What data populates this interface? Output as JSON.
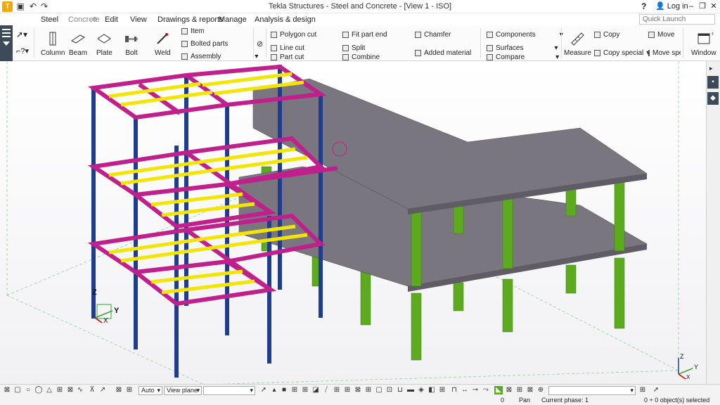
{
  "window": {
    "title": "Tekla Structures - Steel and Concrete  - [View 1 - ISO]",
    "help": "?",
    "login": "Log in"
  },
  "tabs": [
    "Steel",
    "Concrete",
    "Edit",
    "View",
    "Drawings & reports",
    "Manage",
    "Analysis & design"
  ],
  "quick_launch": {
    "placeholder": "Quick Launch"
  },
  "ribbon": {
    "column": "Column",
    "beam": "Beam",
    "plate": "Plate",
    "bolt": "Bolt",
    "weld": "Weld",
    "item": "Item",
    "bolted_parts": "Bolted parts",
    "assembly": "Assembly",
    "polygon_cut": "Polygon cut",
    "line_cut": "Line cut",
    "part_cut": "Part cut",
    "fit_part_end": "Fit part end",
    "split": "Split",
    "combine": "Combine",
    "chamfer": "Chamfer",
    "added_material": "Added material",
    "components": "Components",
    "surfaces": "Surfaces",
    "compare": "Compare",
    "measure": "Measure",
    "copy": "Copy",
    "copy_special": "Copy special",
    "move": "Move",
    "move_special": "Move speci",
    "window": "Window"
  },
  "viewport": {
    "axis_z": "Z",
    "axis_y": "Y",
    "axis_x": "X"
  },
  "toolbar": {
    "auto": "Auto",
    "view_plane": "View plane",
    "filter": ""
  },
  "status": {
    "count": "0",
    "mode": "Pan",
    "phase": "Current phase: 1",
    "selected": "0 + 0 object(s) selected"
  },
  "colors": {
    "column": "#1f3d8f",
    "beam": "#c0208b",
    "joist": "#f2e500",
    "concrete_col": "#5cab1e",
    "slab": "#7a7680",
    "accent": "#f2a900"
  }
}
